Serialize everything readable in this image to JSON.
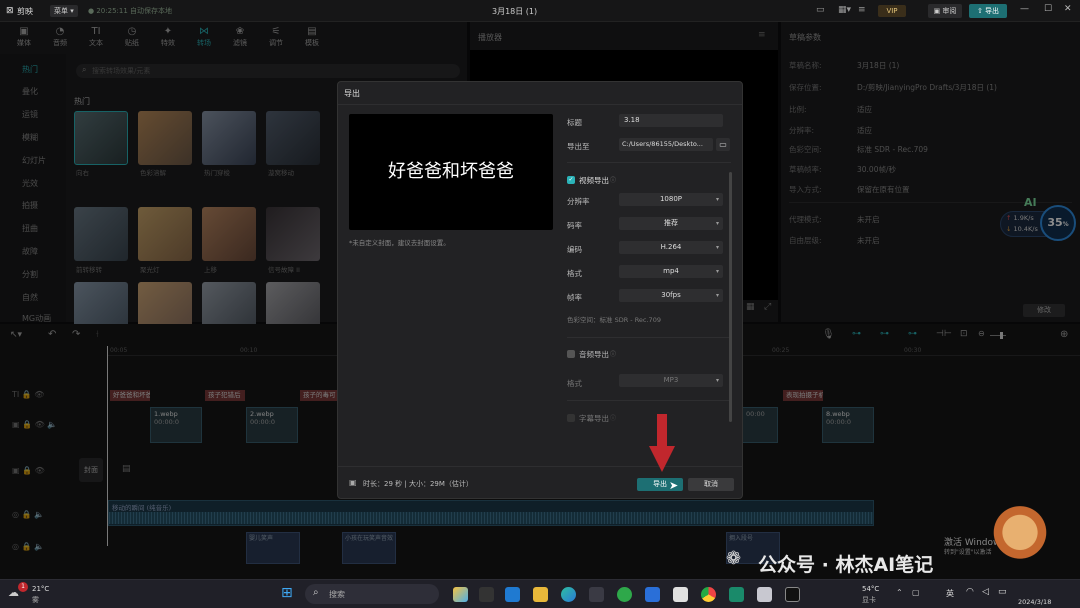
{
  "titlebar": {
    "app_name": "剪映",
    "menu_label": "菜单",
    "autosave": "20:25:11 自动保存本地",
    "title": "3月18日 (1)",
    "vip": "VIP",
    "review": "审阅",
    "export": "导出"
  },
  "toolbar": {
    "items": [
      "媒体",
      "音频",
      "文本",
      "贴纸",
      "特效",
      "转场",
      "滤镜",
      "调节",
      "模板"
    ]
  },
  "media": {
    "search_placeholder": "搜索转场效果/元素",
    "section": "热门",
    "sidebar": [
      "热门",
      "叠化",
      "运镜",
      "模糊",
      "幻灯片",
      "光效",
      "拍摄",
      "扭曲",
      "故障",
      "分割",
      "自然",
      "MG动画"
    ],
    "thumbs_row1": [
      "向右",
      "色彩溶解",
      "热门穿梭",
      "漩窝移动"
    ],
    "thumbs_row2": [
      "前转移转",
      "聚光灯",
      "上移",
      "信号故障 II"
    ],
    "thumbs_row3": [
      "",
      "",
      "",
      ""
    ]
  },
  "player": {
    "title": "播放器"
  },
  "draft": {
    "title": "草稿参数",
    "rows": [
      {
        "label": "草稿名称:",
        "value": "3月18日 (1)"
      },
      {
        "label": "保存位置:",
        "value": "D:/剪映/JianyingPro Drafts/3月18日 (1)"
      },
      {
        "label": "比例:",
        "value": "适应"
      },
      {
        "label": "分辨率:",
        "value": "适应"
      },
      {
        "label": "色彩空间:",
        "value": "标准 SDR - Rec.709"
      },
      {
        "label": "草稿帧率:",
        "value": "30.00帧/秒"
      },
      {
        "label": "导入方式:",
        "value": "保留在原有位置"
      },
      {
        "label": "代理模式:",
        "value": "未开启"
      },
      {
        "label": "自由层级:",
        "value": "未开启"
      }
    ],
    "modify": "修改"
  },
  "netmon": {
    "up": "1.9K/s",
    "down": "10.4K/s",
    "percent": "35",
    "pct_sign": "%",
    "ai": "AI"
  },
  "timeline": {
    "ticks": [
      "00:05",
      "00:10",
      "00:25",
      "00:30"
    ],
    "cover": "封面",
    "text_clips": [
      "好爸爸和坏爸爸",
      "孩子犯错后",
      "孩子的毒可",
      "表现拍摄子机"
    ],
    "video_clips": [
      {
        "name": "1.webp",
        "time": "00:00:0"
      },
      {
        "name": "2.webp",
        "time": "00:00:0"
      },
      {
        "name": "",
        "time": "00:00"
      },
      {
        "name": "8.webp",
        "time": "00:00:0"
      }
    ],
    "audio_main": "移动的瞬间 (纯音乐)",
    "audio_clips": [
      "婴儿笑声",
      "小孩在玩笑声音效",
      "拥入段号"
    ]
  },
  "dialog": {
    "title": "导出",
    "preview_text": "好爸爸和坏爸爸",
    "cover_hint": "*未自定义封面，建议去封面设置。",
    "title_label": "标题",
    "title_value": "3.18",
    "path_label": "导出至",
    "path_value": "C:/Users/86155/Deskto...",
    "video_section": "视频导出",
    "video_fields": [
      {
        "label": "分辨率",
        "value": "1080P"
      },
      {
        "label": "码率",
        "value": "推荐"
      },
      {
        "label": "编码",
        "value": "H.264"
      },
      {
        "label": "格式",
        "value": "mp4"
      },
      {
        "label": "帧率",
        "value": "30fps"
      }
    ],
    "color_space": "色彩空间：标准 SDR - Rec.709",
    "audio_section": "音频导出",
    "audio_format_label": "格式",
    "audio_format_value": "MP3",
    "subtitle_section": "字幕导出",
    "info": "时长：29 秒 | 大小：29M（估计）",
    "export_button": "导出",
    "cancel_button": "取消"
  },
  "watermark": {
    "activate": "激活 Windows",
    "activate_sub": "转到\"设置\"以激活",
    "account": "公众号 · 林杰AI笔记"
  },
  "taskbar": {
    "weather_temp": "21°C",
    "weather_desc": "雾",
    "badge": "1",
    "search": "搜索",
    "right_temp": "54°C",
    "right_label": "显卡",
    "lang": "英",
    "date": "2024/3/18"
  },
  "colors": {
    "accent": "#2bb3b8",
    "export_btn": "#1d6f73",
    "arrow": "#c1272d"
  }
}
